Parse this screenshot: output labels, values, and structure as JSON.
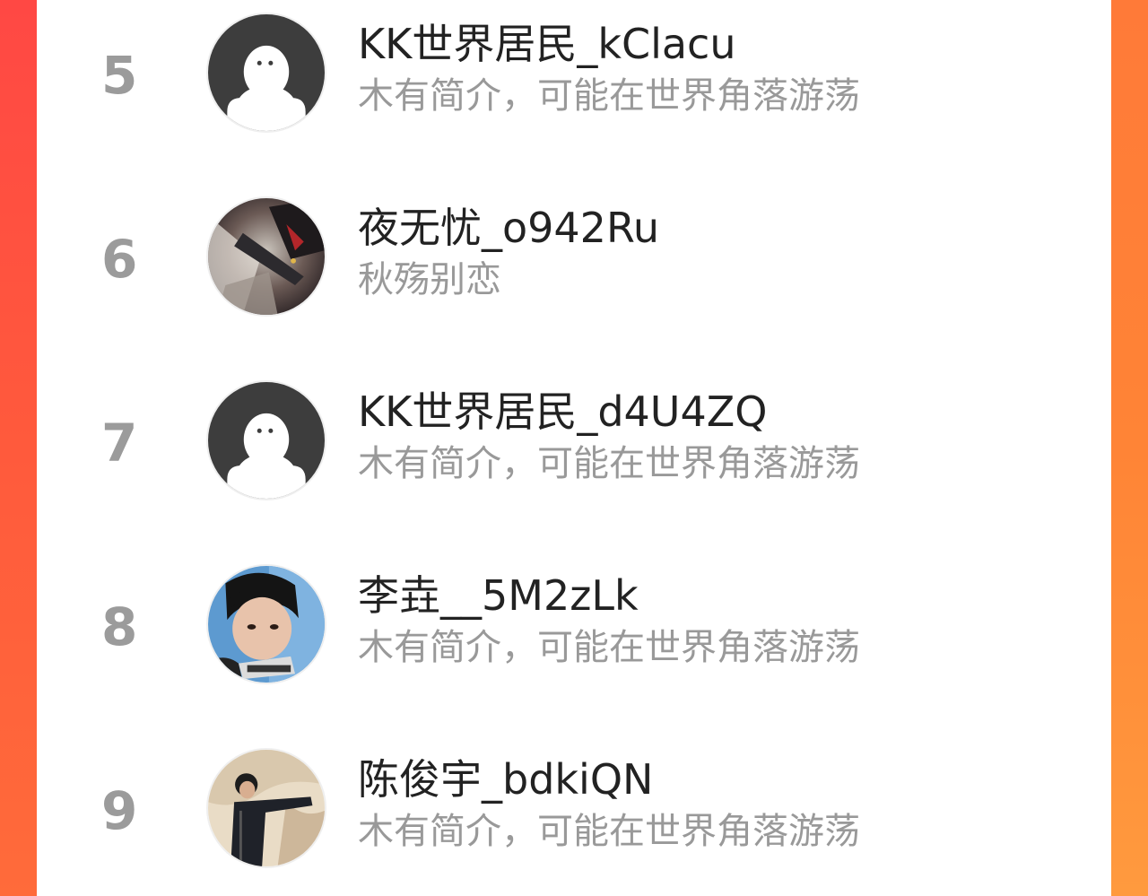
{
  "colors": {
    "background_left": "#ff4844",
    "background_right": "#ff8a3d",
    "card": "#ffffff",
    "rank_text": "#9b9b9b",
    "name_text": "#222222",
    "desc_text": "#999999",
    "default_avatar": "#3d3d3d"
  },
  "ranking": {
    "items": [
      {
        "rank": "5",
        "name": "KK世界居民_kClacu",
        "bio": "木有简介，可能在世界角落游荡",
        "avatar": "default-avatar-icon"
      },
      {
        "rank": "6",
        "name": "夜无忧_o942Ru",
        "bio": "秋殇别恋",
        "avatar": "anime-artwork-avatar"
      },
      {
        "rank": "7",
        "name": "KK世界居民_d4U4ZQ",
        "bio": "木有简介，可能在世界角落游荡",
        "avatar": "default-avatar-icon"
      },
      {
        "rank": "8",
        "name": "李垚__5M2zLk",
        "bio": "木有简介，可能在世界角落游荡",
        "avatar": "photo-avatar"
      },
      {
        "rank": "9",
        "name": "陈俊宇_bdkiQN",
        "bio": "木有简介，可能在世界角落游荡",
        "avatar": "photo-avatar"
      }
    ]
  }
}
